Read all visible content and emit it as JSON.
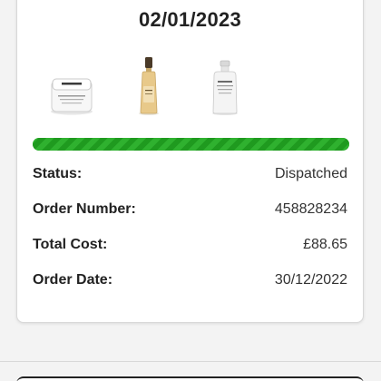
{
  "order": {
    "date": "02/01/2023",
    "progress": 1.0,
    "products": [
      {
        "name": "cream-jar",
        "icon": "cream-jar-icon"
      },
      {
        "name": "oil-bottle",
        "icon": "oil-bottle-icon"
      },
      {
        "name": "serum-spray-bottle",
        "icon": "spray-bottle-icon"
      }
    ],
    "details": [
      {
        "label": "Status:",
        "value": "Dispatched"
      },
      {
        "label": "Order Number:",
        "value": "458828234"
      },
      {
        "label": "Total Cost:",
        "value": "£88.65"
      },
      {
        "label": "Order Date:",
        "value": "30/12/2022"
      }
    ]
  },
  "colors": {
    "progress": "#2fb12f",
    "progress_stripe": "#1c9a1c",
    "card_bg": "#ffffff",
    "page_bg": "#f3f3f3"
  }
}
